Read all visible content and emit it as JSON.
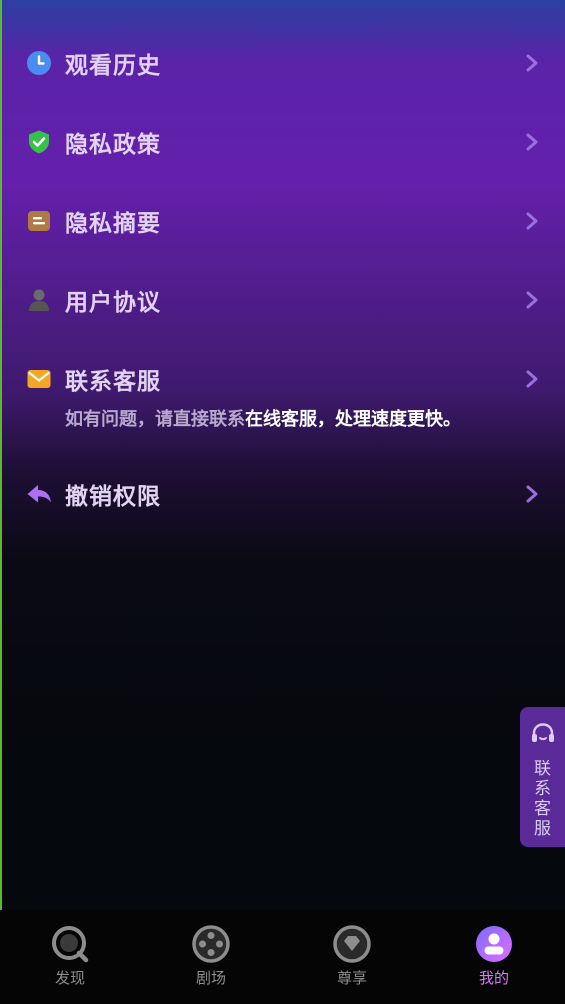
{
  "menu": {
    "items": [
      {
        "label": "观看历史",
        "icon": "clock-icon"
      },
      {
        "label": "隐私政策",
        "icon": "shield-check-icon"
      },
      {
        "label": "隐私摘要",
        "icon": "document-icon"
      },
      {
        "label": "用户协议",
        "icon": "user-icon"
      },
      {
        "label": "联系客服",
        "icon": "mail-icon"
      },
      {
        "label": "撤销权限",
        "icon": "revoke-arrow-icon"
      }
    ],
    "contact_note": {
      "prefix": "如有问题，请直接联系",
      "highlight": "在线客服，处理速度更快。"
    }
  },
  "floating_support": {
    "chars": [
      "联",
      "系",
      "客",
      "服"
    ],
    "icon": "headset-icon"
  },
  "tabbar": {
    "tabs": [
      {
        "label": "发现",
        "icon": "discover-icon",
        "active": false
      },
      {
        "label": "剧场",
        "icon": "film-reel-icon",
        "active": false
      },
      {
        "label": "尊享",
        "icon": "diamond-icon",
        "active": false
      },
      {
        "label": "我的",
        "icon": "profile-icon",
        "active": true
      }
    ]
  },
  "colors": {
    "accent": "#d978ff",
    "label": "#e3d3f3",
    "chevron": "#9b6fe0",
    "tab_inactive": "#8d8d8d",
    "edge": "#5cb82e"
  }
}
